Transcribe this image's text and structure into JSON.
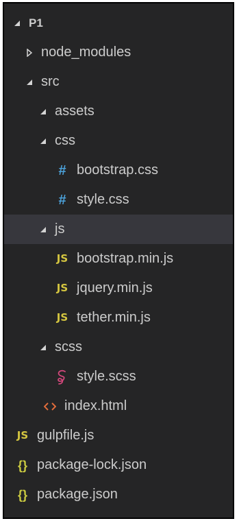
{
  "explorer": {
    "root": {
      "label": "P1",
      "expanded": true
    },
    "items": [
      {
        "label": "node_modules",
        "type": "folder",
        "expanded": false
      },
      {
        "label": "src",
        "type": "folder",
        "expanded": true
      },
      {
        "label": "assets",
        "type": "folder",
        "expanded": true
      },
      {
        "label": "css",
        "type": "folder",
        "expanded": true
      },
      {
        "label": "bootstrap.css",
        "type": "file",
        "icon": "css-hash-icon",
        "icon_glyph": "#"
      },
      {
        "label": "style.css",
        "type": "file",
        "icon": "css-hash-icon",
        "icon_glyph": "#"
      },
      {
        "label": "js",
        "type": "folder",
        "expanded": true,
        "selected": true
      },
      {
        "label": "bootstrap.min.js",
        "type": "file",
        "icon": "js-icon",
        "icon_glyph": "JS"
      },
      {
        "label": "jquery.min.js",
        "type": "file",
        "icon": "js-icon",
        "icon_glyph": "JS"
      },
      {
        "label": "tether.min.js",
        "type": "file",
        "icon": "js-icon",
        "icon_glyph": "JS"
      },
      {
        "label": "scss",
        "type": "folder",
        "expanded": true
      },
      {
        "label": "style.scss",
        "type": "file",
        "icon": "sass-icon",
        "icon_glyph": "℘"
      },
      {
        "label": "index.html",
        "type": "file",
        "icon": "html-icon",
        "icon_glyph": "<>"
      },
      {
        "label": "gulpfile.js",
        "type": "file",
        "icon": "js-icon",
        "icon_glyph": "JS"
      },
      {
        "label": "package-lock.json",
        "type": "file",
        "icon": "json-icon",
        "icon_glyph": "{}"
      },
      {
        "label": "package.json",
        "type": "file",
        "icon": "json-icon",
        "icon_glyph": "{}"
      }
    ]
  },
  "colors": {
    "background": "#252526",
    "selected_row": "#37373d",
    "text": "#cccccc",
    "css_icon": "#4ca2db",
    "js_icon": "#d5c640",
    "html_icon": "#e06c3b",
    "json_icon": "#cbcb41",
    "scss_icon": "#d1477a"
  }
}
